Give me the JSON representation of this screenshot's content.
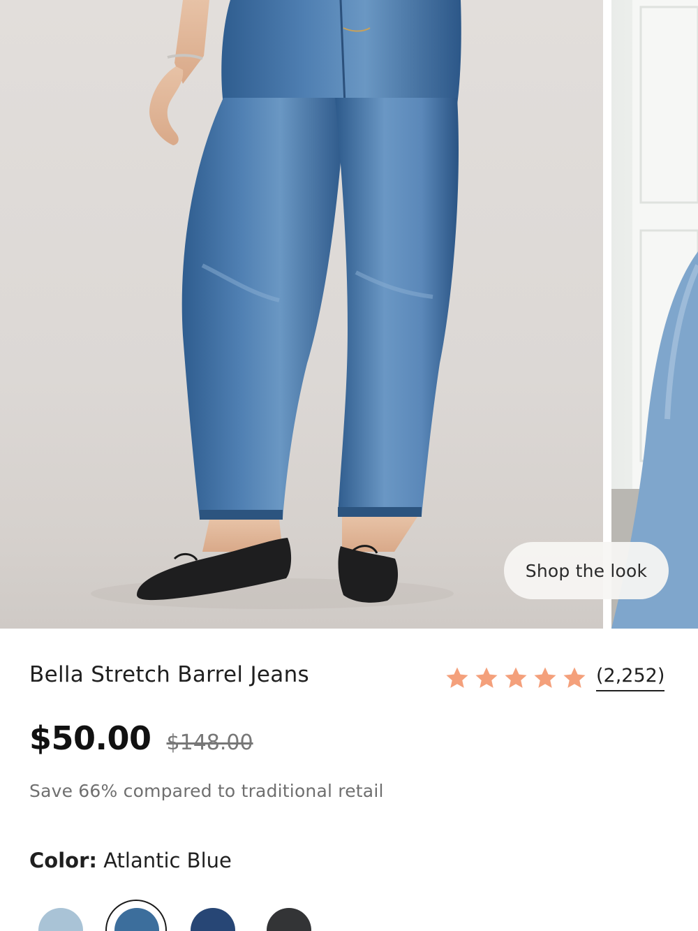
{
  "gallery": {
    "main_image_alt": "",
    "shop_the_look_label": "Shop the look"
  },
  "product": {
    "title": "Bella Stretch Barrel Jeans",
    "rating_value": 5,
    "rating_max": 5,
    "review_count": "(2,252)",
    "price_current": "$50.00",
    "price_original": "$148.00",
    "savings_note": "Save 66% compared to traditional retail"
  },
  "color": {
    "label": "Color:",
    "selected": "Atlantic Blue",
    "swatches": [
      {
        "hex": "#a9c3d6",
        "selected": false
      },
      {
        "hex": "#3c6e9c",
        "selected": true
      },
      {
        "hex": "#274675",
        "selected": false
      },
      {
        "hex": "#333436",
        "selected": false
      }
    ]
  },
  "colors": {
    "star": "#f4a07b",
    "text": "#1f1f1f",
    "muted": "#6f6f6f"
  }
}
